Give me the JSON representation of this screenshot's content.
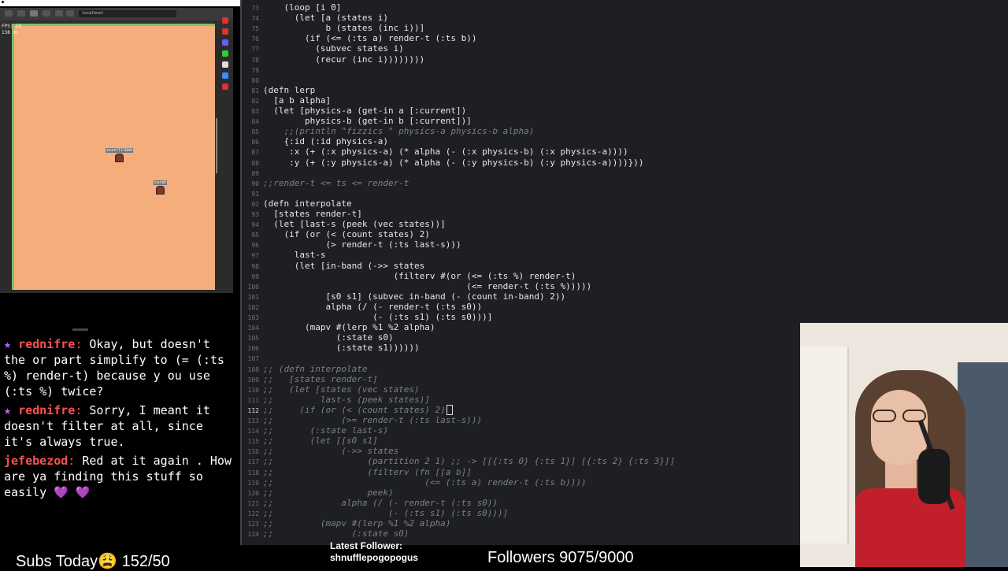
{
  "browser": {
    "url": "localhost",
    "hud_line1": "FPS: 60",
    "hud_line2": "138 ms",
    "players": [
      {
        "name": "zzzzllllbbb"
      },
      {
        "name": "sarah"
      }
    ]
  },
  "chat": {
    "messages": [
      {
        "user": "rednifre",
        "badge": "star",
        "text": "Okay, but doesn't the or part simplify to (= (:ts %) render-t) because y ou use (:ts %) twice?"
      },
      {
        "user": "rednifre",
        "badge": "star",
        "text": "Sorry, I meant it doesn't filter at all, since it's always true."
      },
      {
        "user": "jefebezod",
        "badge": "",
        "text": "Red at it again . How are ya finding this stuff so easily",
        "emotes": "💜 💜"
      }
    ]
  },
  "overlay": {
    "subs_today": "Subs Today😩 152/50",
    "latest_follower_label": "Latest Follower:",
    "latest_follower_name": "shnufflepogopogus",
    "followers_goal": "Followers 9075/9000"
  },
  "editor": {
    "lines": [
      {
        "n": "73",
        "t": "    (loop [i 0]",
        "c": false
      },
      {
        "n": "74",
        "t": "      (let [a (states i)",
        "c": false
      },
      {
        "n": "75",
        "t": "            b (states (inc i))]",
        "c": false
      },
      {
        "n": "76",
        "t": "        (if (<= (:ts a) render-t (:ts b))",
        "c": false
      },
      {
        "n": "77",
        "t": "          (subvec states i)",
        "c": false
      },
      {
        "n": "78",
        "t": "          (recur (inc i))))))))",
        "c": false
      },
      {
        "n": "79",
        "t": "",
        "c": false
      },
      {
        "n": "80",
        "t": "",
        "c": false
      },
      {
        "n": "81",
        "t": "(defn lerp",
        "c": false
      },
      {
        "n": "82",
        "t": "  [a b alpha]",
        "c": false
      },
      {
        "n": "83",
        "t": "  (let [physics-a (get-in a [:current])",
        "c": false
      },
      {
        "n": "84",
        "t": "        physics-b (get-in b [:current])]",
        "c": false
      },
      {
        "n": "85",
        "t": "    ;;(println \"fizzics \" physics-a physics-b alpha)",
        "c": true
      },
      {
        "n": "86",
        "t": "    {:id (:id physics-a)",
        "c": false
      },
      {
        "n": "87",
        "t": "     :x (+ (:x physics-a) (* alpha (- (:x physics-b) (:x physics-a))))",
        "c": false
      },
      {
        "n": "88",
        "t": "     :y (+ (:y physics-a) (* alpha (- (:y physics-b) (:y physics-a))))}))",
        "c": false
      },
      {
        "n": "89",
        "t": "",
        "c": false
      },
      {
        "n": "90",
        "t": ";;render-t <= ts <= render-t",
        "c": true
      },
      {
        "n": "91",
        "t": "",
        "c": false
      },
      {
        "n": "92",
        "t": "(defn interpolate",
        "c": false
      },
      {
        "n": "93",
        "t": "  [states render-t]",
        "c": false
      },
      {
        "n": "94",
        "t": "  (let [last-s (peek (vec states))]",
        "c": false
      },
      {
        "n": "95",
        "t": "    (if (or (< (count states) 2)",
        "c": false
      },
      {
        "n": "96",
        "t": "            (> render-t (:ts last-s)))",
        "c": false
      },
      {
        "n": "97",
        "t": "      last-s",
        "c": false
      },
      {
        "n": "98",
        "t": "      (let [in-band (->> states",
        "c": false
      },
      {
        "n": "99",
        "t": "                         (filterv #(or (<= (:ts %) render-t)",
        "c": false
      },
      {
        "n": "100",
        "t": "                                       (<= render-t (:ts %)))))",
        "c": false
      },
      {
        "n": "101",
        "t": "            [s0 s1] (subvec in-band (- (count in-band) 2))",
        "c": false
      },
      {
        "n": "102",
        "t": "            alpha (/ (- render-t (:ts s0))",
        "c": false
      },
      {
        "n": "103",
        "t": "                     (- (:ts s1) (:ts s0)))]",
        "c": false
      },
      {
        "n": "104",
        "t": "        (mapv #(lerp %1 %2 alpha)",
        "c": false
      },
      {
        "n": "105",
        "t": "              (:state s0)",
        "c": false
      },
      {
        "n": "106",
        "t": "              (:state s1))))))",
        "c": false
      },
      {
        "n": "107",
        "t": "",
        "c": false
      },
      {
        "n": "108",
        "t": ";; (defn interpolate",
        "c": true
      },
      {
        "n": "109",
        "t": ";;   [states render-t]",
        "c": true
      },
      {
        "n": "110",
        "t": ";;   (let [states (vec states)",
        "c": true
      },
      {
        "n": "111",
        "t": ";;         last-s (peek states)]",
        "c": true
      },
      {
        "n": "112",
        "t": ";;     (if (or (< (count states) 2)",
        "c": true,
        "hl": true
      },
      {
        "n": "113",
        "t": ";;             (>= render-t (:ts last-s)))",
        "c": true
      },
      {
        "n": "114",
        "t": ";;       (:state last-s)",
        "c": true
      },
      {
        "n": "115",
        "t": ";;       (let [[s0 s1]",
        "c": true
      },
      {
        "n": "116",
        "t": ";;             (->> states",
        "c": true
      },
      {
        "n": "117",
        "t": ";;                  (partition 2 1) ;; -> [[{:ts 0} {:ts 1}] [{:ts 2} {:ts 3}]]",
        "c": true
      },
      {
        "n": "118",
        "t": ";;                  (filterv (fn [[a b]]",
        "c": true
      },
      {
        "n": "119",
        "t": ";;                             (<= (:ts a) render-t (:ts b))))",
        "c": true
      },
      {
        "n": "120",
        "t": ";;                  peek)",
        "c": true
      },
      {
        "n": "121",
        "t": ";;             alpha (/ (- render-t (:ts s0))",
        "c": true
      },
      {
        "n": "122",
        "t": ";;                      (- (:ts s1) (:ts s0)))]",
        "c": true
      },
      {
        "n": "123",
        "t": ";;         (mapv #(lerp %1 %2 alpha)",
        "c": true
      },
      {
        "n": "124",
        "t": ";;               (:state s0)",
        "c": true
      }
    ]
  }
}
